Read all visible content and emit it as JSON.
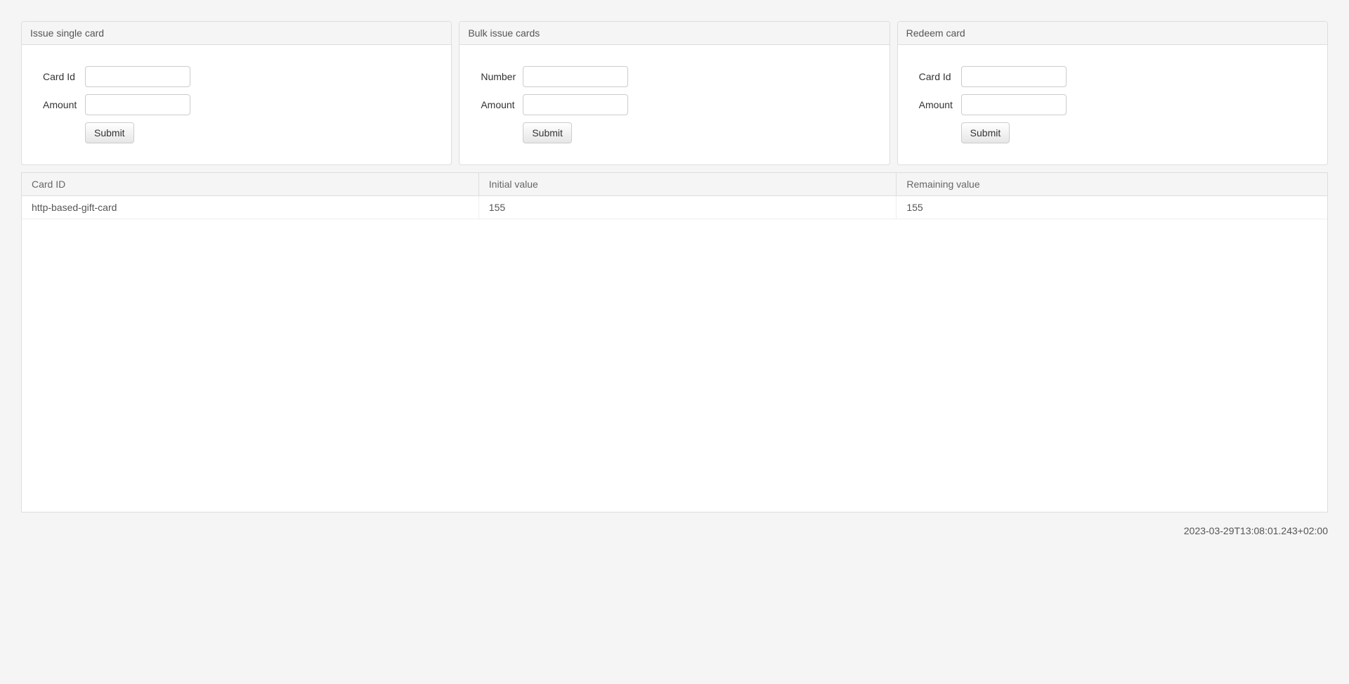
{
  "panels": {
    "issue_single": {
      "title": "Issue single card",
      "card_id_label": "Card Id",
      "amount_label": "Amount",
      "submit_label": "Submit"
    },
    "bulk_issue": {
      "title": "Bulk issue cards",
      "number_label": "Number",
      "amount_label": "Amount",
      "submit_label": "Submit"
    },
    "redeem": {
      "title": "Redeem card",
      "card_id_label": "Card Id",
      "amount_label": "Amount",
      "submit_label": "Submit"
    }
  },
  "table": {
    "headers": {
      "card_id": "Card ID",
      "initial_value": "Initial value",
      "remaining_value": "Remaining value"
    },
    "rows": [
      {
        "card_id": "http-based-gift-card",
        "initial_value": "155",
        "remaining_value": "155"
      }
    ]
  },
  "timestamp": "2023-03-29T13:08:01.243+02:00"
}
